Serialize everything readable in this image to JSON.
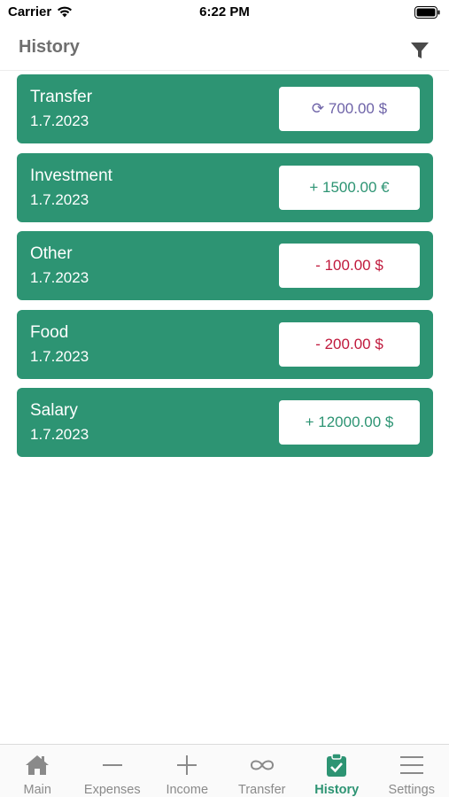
{
  "status_bar": {
    "carrier": "Carrier",
    "time": "6:22 PM"
  },
  "header": {
    "title": "History",
    "filter_icon": "filter-icon"
  },
  "colors": {
    "accent": "#2d9473",
    "transfer_amount": "#6e63a8",
    "income_amount": "#2d9473",
    "expense_amount": "#c0193c"
  },
  "transactions": [
    {
      "category": "Transfer",
      "date": "1.7.2023",
      "amount": "⟳ 700.00 $",
      "kind": "transfer"
    },
    {
      "category": "Investment",
      "date": "1.7.2023",
      "amount": "+ 1500.00 €",
      "kind": "income"
    },
    {
      "category": "Other",
      "date": "1.7.2023",
      "amount": "- 100.00 $",
      "kind": "expense"
    },
    {
      "category": "Food",
      "date": "1.7.2023",
      "amount": "- 200.00 $",
      "kind": "expense"
    },
    {
      "category": "Salary",
      "date": "1.7.2023",
      "amount": "+ 12000.00 $",
      "kind": "income"
    }
  ],
  "tabs": [
    {
      "label": "Main",
      "icon": "home-icon"
    },
    {
      "label": "Expenses",
      "icon": "minus-icon"
    },
    {
      "label": "Income",
      "icon": "plus-icon"
    },
    {
      "label": "Transfer",
      "icon": "infinity-icon"
    },
    {
      "label": "History",
      "icon": "clipboard-check-icon",
      "active": true
    },
    {
      "label": "Settings",
      "icon": "menu-icon"
    }
  ]
}
